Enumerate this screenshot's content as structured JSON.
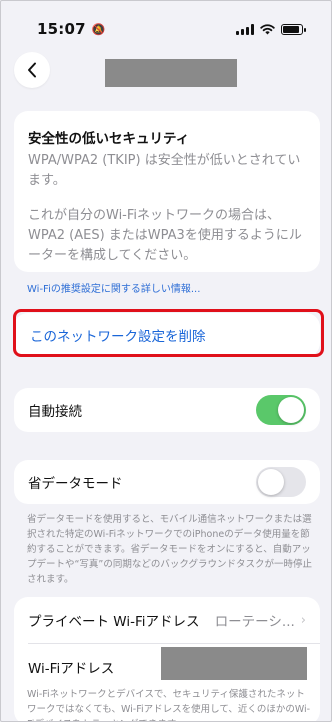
{
  "status": {
    "time": "15:07"
  },
  "warning": {
    "title": "安全性の低いセキュリティ",
    "paragraph1": "WPA/WPA2 (TKIP) は安全性が低いとされています。",
    "paragraph2": "これが自分のWi-Fiネットワークの場合は、WPA2 (AES) またはWPA3を使用するようにルーターを構成してください。"
  },
  "recommend_link": "Wi-Fiの推奨設定に関する詳しい情報...",
  "forget_network": "このネットワーク設定を削除",
  "auto_join": {
    "label": "自動接続",
    "on": true
  },
  "low_data": {
    "label": "省データモード",
    "on": false,
    "note": "省データモードを使用すると、モバイル通信ネットワークまたは選択された特定のWi-FiネットワークでのiPhoneのデータ使用量を節約することができます。省データモードをオンにすると、自動アップデートや“写真”の同期などのバックグラウンドタスクが一時停止されます。"
  },
  "private_address": {
    "label": "プライベート Wi-Fiアドレス",
    "value": "ローテーシ..."
  },
  "wifi_address": {
    "label": "Wi-Fiアドレス"
  },
  "bottom_note": "Wi-Fiネットワークとデバイスで、セキュリティ保護されたネットワークではなくても、Wi-Fiアドレスを使用して、近くのほかのWi-Fiデバイスをトラッキングできます。",
  "colors": {
    "toggle_on": "#5ac86a",
    "link": "#1a66d8",
    "highlight": "#e0101a"
  }
}
